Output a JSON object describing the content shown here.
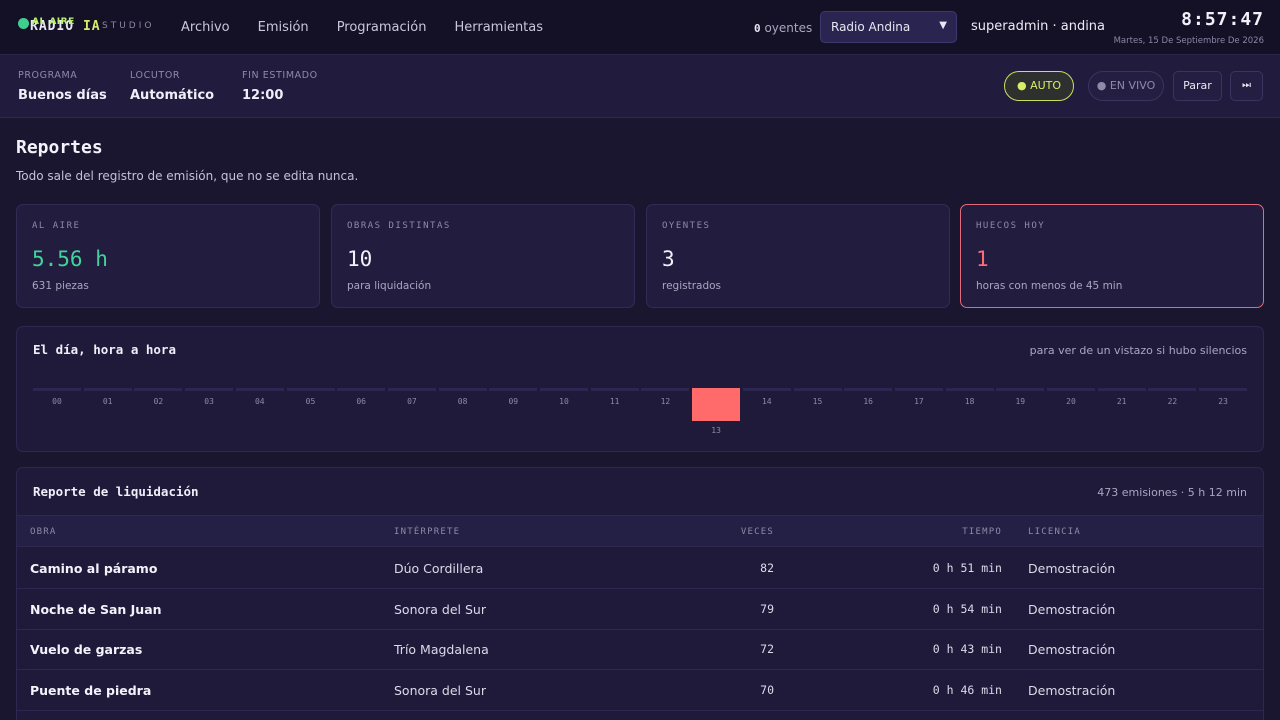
{
  "brand": {
    "onair_badge": "AL AIRE",
    "name_main": "RADIO ",
    "name_accent": "IA",
    "subtitle": "STUDIO"
  },
  "nav": {
    "items": [
      "Archivo",
      "Emisión",
      "Programación",
      "Herramientas"
    ]
  },
  "header": {
    "listeners_count": "0",
    "listeners_label": "oyentes",
    "station_selected": "Radio Andina",
    "user": "superadmin · andina",
    "clock": "8:57:47",
    "date": "Martes, 15 De Septiembre De 2026"
  },
  "program": {
    "program_label": "PROGRAMA",
    "program_value": "Buenos días",
    "host_label": "LOCUTOR",
    "host_value": "Automático",
    "end_label": "FIN ESTIMADO",
    "end_value": "12:00",
    "auto_label": "● AUTO",
    "live_label": "● EN VIVO",
    "stop_label": "Parar",
    "next_icon": "⏭"
  },
  "page": {
    "title": "Reportes",
    "subtitle": "Todo sale del registro de emisión, que no se edita nunca."
  },
  "stats": [
    {
      "label": "AL AIRE",
      "value": "5.56 h",
      "note": "631 piezas"
    },
    {
      "label": "OBRAS DISTINTAS",
      "value": "10",
      "note": "para liquidación"
    },
    {
      "label": "OYENTES",
      "value": "3",
      "note": "registrados"
    },
    {
      "label": "HUECOS HOY",
      "value": "1",
      "note": "horas con menos de 45 min"
    }
  ],
  "hourly": {
    "title": "El día, hora a hora",
    "note": "para ver de un vistazo si hubo silencios",
    "hours": [
      "00",
      "01",
      "02",
      "03",
      "04",
      "05",
      "06",
      "07",
      "08",
      "09",
      "10",
      "11",
      "12",
      "13",
      "14",
      "15",
      "16",
      "17",
      "18",
      "19",
      "20",
      "21",
      "22",
      "23"
    ],
    "gap_hours": [
      "13"
    ]
  },
  "report": {
    "title": "Reporte de liquidación",
    "summary": "473 emisiones · 5 h 12 min",
    "columns": [
      "OBRA",
      "INTÉRPRETE",
      "VECES",
      "TIEMPO",
      "LICENCIA"
    ],
    "rows": [
      {
        "work": "Camino al páramo",
        "artist": "Dúo Cordillera",
        "times": "82",
        "duration": "0 h 51 min",
        "license": "Demostración"
      },
      {
        "work": "Noche de San Juan",
        "artist": "Sonora del Sur",
        "times": "79",
        "duration": "0 h 54 min",
        "license": "Demostración"
      },
      {
        "work": "Vuelo de garzas",
        "artist": "Trío Magdalena",
        "times": "72",
        "duration": "0 h 43 min",
        "license": "Demostración"
      },
      {
        "work": "Puente de piedra",
        "artist": "Sonora del Sur",
        "times": "70",
        "duration": "0 h 46 min",
        "license": "Demostración"
      }
    ]
  },
  "colors": {
    "accent_green": "#41d39c",
    "accent_red": "#ff6b78",
    "accent_lime": "#d8ee6a",
    "background": "#1a1630"
  }
}
